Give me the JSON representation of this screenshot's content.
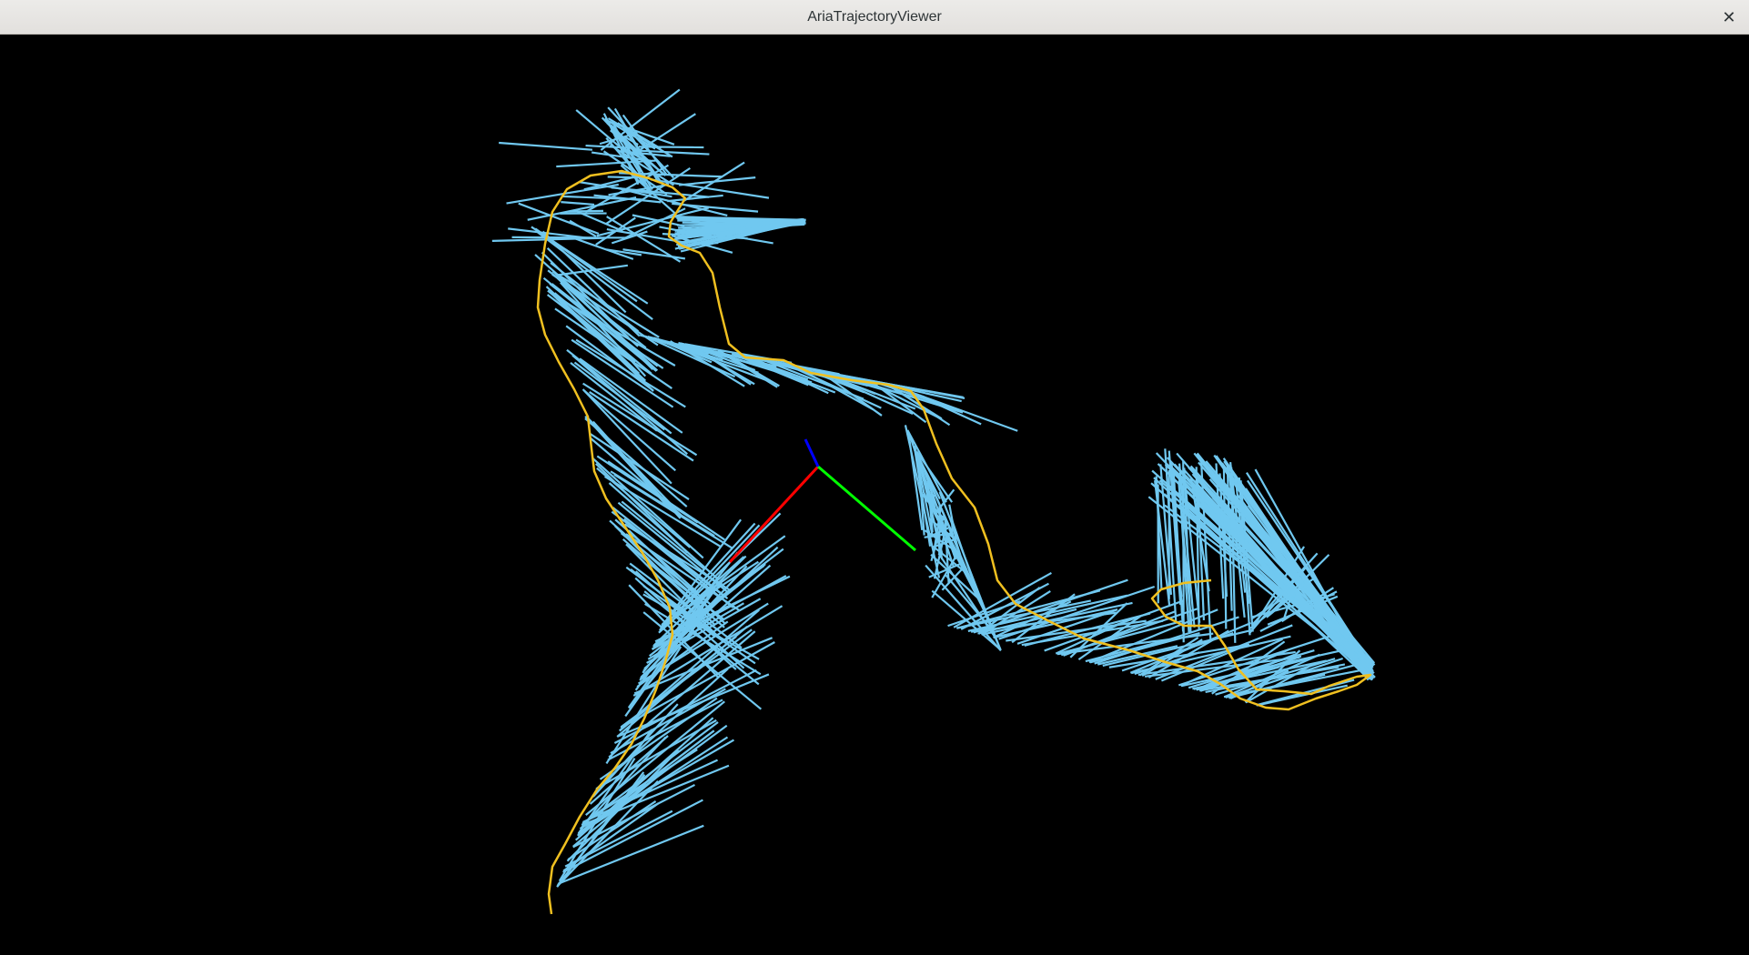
{
  "window": {
    "title": "AriaTrajectoryViewer",
    "close_icon": "close-icon",
    "close_glyph": "✕"
  },
  "viewer": {
    "background": "#000000",
    "trajectory_color": "#f0c020",
    "ray_color": "#70c8f0",
    "axes": {
      "x_color": "#ff0000",
      "y_color": "#00ff00",
      "z_color": "#0000ff"
    }
  }
}
